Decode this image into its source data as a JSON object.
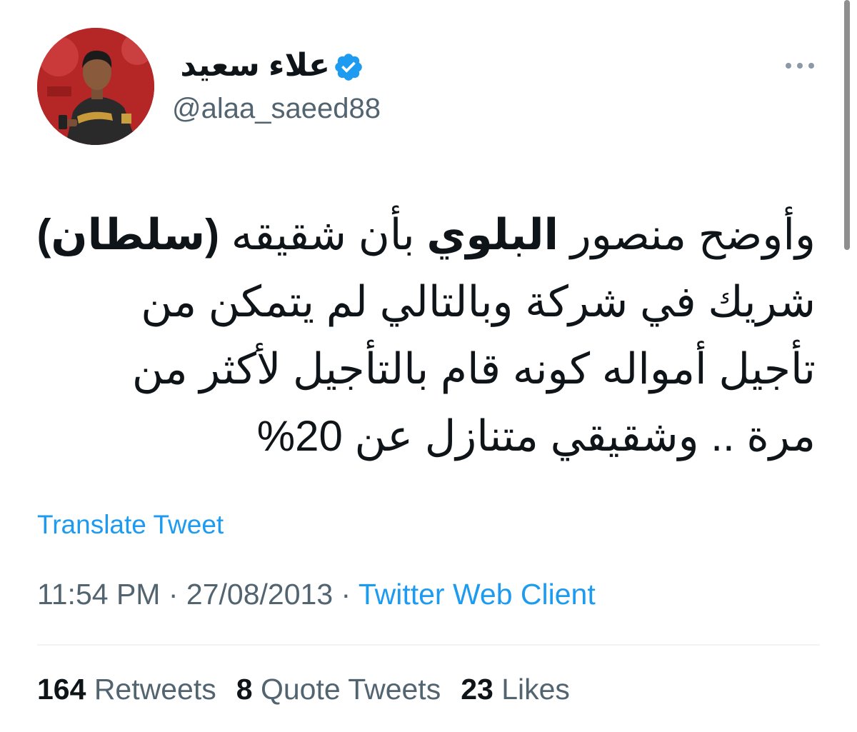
{
  "user": {
    "display_name": "علاء سعيد",
    "handle": "@alaa_saeed88",
    "verified": true,
    "avatar": "profile-photo"
  },
  "tweet": {
    "lines": [
      {
        "pre": "وأوضح منصور ",
        "bold": "البلوي",
        "post": " بأن شقيقه ",
        "bold2": "(سلطان)"
      },
      {
        "text": "شريك في شركة وبالتالي لم يتمكن من"
      },
      {
        "text": "تأجيل أمواله كونه قام بالتأجيل لأكثر من"
      },
      {
        "text": "مرة .. وشقيقي متنازل عن 20%"
      }
    ]
  },
  "translate_label": "Translate Tweet",
  "meta": {
    "time": "11:54 PM",
    "separator": "·",
    "date": "27/08/2013",
    "source": "Twitter Web Client"
  },
  "stats": {
    "retweets_count": "164",
    "retweets_label": "Retweets",
    "quotes_count": "8",
    "quotes_label": "Quote Tweets",
    "likes_count": "23",
    "likes_label": "Likes"
  },
  "colors": {
    "accent": "#1d9bf0",
    "secondary_text": "#536471",
    "primary_text": "#0f1419"
  },
  "icons": {
    "verified": "verified-badge-icon",
    "more": "more-horizontal-icon"
  }
}
